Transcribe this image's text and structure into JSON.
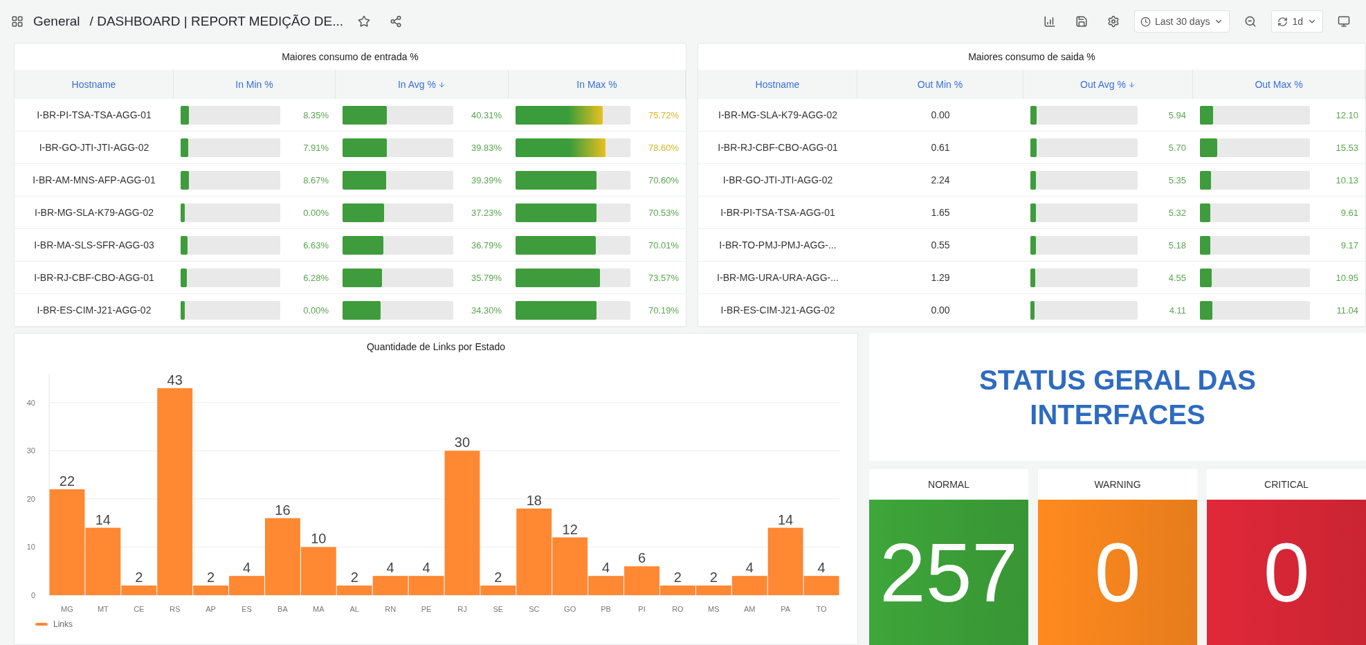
{
  "topbar": {
    "breadcrumb": "General",
    "title": "/ DASHBOARD | REPORT MEDIÇÃO DE...",
    "time_range": "Last 30 days",
    "refresh_interval": "1d"
  },
  "tables": [
    {
      "title": "Maiores consumo de entrada %",
      "columns": [
        {
          "label": "Hostname",
          "sorted": false
        },
        {
          "label": "In Min %",
          "sorted": false
        },
        {
          "label": "In Avg %",
          "sorted": true
        },
        {
          "label": "In Max %",
          "sorted": false
        }
      ],
      "rows": [
        {
          "cells": [
            {
              "kind": "text",
              "text": "I-BR-PI-TSA-TSA-AGG-01"
            },
            {
              "kind": "gauge",
              "text": "8.35%",
              "level": 0.0835
            },
            {
              "kind": "gauge",
              "text": "40.31%",
              "level": 0.4031
            },
            {
              "kind": "gauge",
              "text": "75.72%",
              "level": 0.7572
            }
          ]
        },
        {
          "cells": [
            {
              "kind": "text",
              "text": "I-BR-GO-JTI-JTI-AGG-02"
            },
            {
              "kind": "gauge",
              "text": "7.91%",
              "level": 0.0791
            },
            {
              "kind": "gauge",
              "text": "39.83%",
              "level": 0.3983
            },
            {
              "kind": "gauge",
              "text": "78.60%",
              "level": 0.786
            }
          ]
        },
        {
          "cells": [
            {
              "kind": "text",
              "text": "I-BR-AM-MNS-AFP-AGG-01"
            },
            {
              "kind": "gauge",
              "text": "8.67%",
              "level": 0.0867
            },
            {
              "kind": "gauge",
              "text": "39.39%",
              "level": 0.3939
            },
            {
              "kind": "gauge",
              "text": "70.60%",
              "level": 0.706
            }
          ]
        },
        {
          "cells": [
            {
              "kind": "text",
              "text": "I-BR-MG-SLA-K79-AGG-02"
            },
            {
              "kind": "gauge",
              "text": "0.00%",
              "level": 0.0
            },
            {
              "kind": "gauge",
              "text": "37.23%",
              "level": 0.3723
            },
            {
              "kind": "gauge",
              "text": "70.53%",
              "level": 0.7053
            }
          ]
        },
        {
          "cells": [
            {
              "kind": "text",
              "text": "I-BR-MA-SLS-SFR-AGG-03"
            },
            {
              "kind": "gauge",
              "text": "6.63%",
              "level": 0.0663
            },
            {
              "kind": "gauge",
              "text": "36.79%",
              "level": 0.3679
            },
            {
              "kind": "gauge",
              "text": "70.01%",
              "level": 0.7001
            }
          ]
        },
        {
          "cells": [
            {
              "kind": "text",
              "text": "I-BR-RJ-CBF-CBO-AGG-01"
            },
            {
              "kind": "gauge",
              "text": "6.28%",
              "level": 0.0628
            },
            {
              "kind": "gauge",
              "text": "35.79%",
              "level": 0.3579
            },
            {
              "kind": "gauge",
              "text": "73.57%",
              "level": 0.7357
            }
          ]
        },
        {
          "cells": [
            {
              "kind": "text",
              "text": "I-BR-ES-CIM-J21-AGG-02"
            },
            {
              "kind": "gauge",
              "text": "0.00%",
              "level": 0.0
            },
            {
              "kind": "gauge",
              "text": "34.30%",
              "level": 0.343
            },
            {
              "kind": "gauge",
              "text": "70.19%",
              "level": 0.7019
            }
          ]
        }
      ]
    },
    {
      "title": "Maiores consumo de saida %",
      "columns": [
        {
          "label": "Hostname",
          "sorted": false
        },
        {
          "label": "Out Min %",
          "sorted": false
        },
        {
          "label": "Out Avg %",
          "sorted": true
        },
        {
          "label": "Out Max %",
          "sorted": false
        }
      ],
      "rows": [
        {
          "cells": [
            {
              "kind": "text",
              "text": "I-BR-MG-SLA-K79-AGG-02"
            },
            {
              "kind": "text",
              "text": "0.00"
            },
            {
              "kind": "gauge",
              "text": "5.94",
              "level": 0.0594
            },
            {
              "kind": "gauge",
              "text": "12.10",
              "level": 0.121
            }
          ]
        },
        {
          "cells": [
            {
              "kind": "text",
              "text": "I-BR-RJ-CBF-CBO-AGG-01"
            },
            {
              "kind": "text",
              "text": "0.61"
            },
            {
              "kind": "gauge",
              "text": "5.70",
              "level": 0.057
            },
            {
              "kind": "gauge",
              "text": "15.53",
              "level": 0.1553
            }
          ]
        },
        {
          "cells": [
            {
              "kind": "text",
              "text": "I-BR-GO-JTI-JTI-AGG-02"
            },
            {
              "kind": "text",
              "text": "2.24"
            },
            {
              "kind": "gauge",
              "text": "5.35",
              "level": 0.0535
            },
            {
              "kind": "gauge",
              "text": "10.13",
              "level": 0.1013
            }
          ]
        },
        {
          "cells": [
            {
              "kind": "text",
              "text": "I-BR-PI-TSA-TSA-AGG-01"
            },
            {
              "kind": "text",
              "text": "1.65"
            },
            {
              "kind": "gauge",
              "text": "5.32",
              "level": 0.0532
            },
            {
              "kind": "gauge",
              "text": "9.61",
              "level": 0.0961
            }
          ]
        },
        {
          "cells": [
            {
              "kind": "text",
              "text": "I-BR-TO-PMJ-PMJ-AGG-..."
            },
            {
              "kind": "text",
              "text": "0.55"
            },
            {
              "kind": "gauge",
              "text": "5.18",
              "level": 0.0518
            },
            {
              "kind": "gauge",
              "text": "9.17",
              "level": 0.0917
            }
          ]
        },
        {
          "cells": [
            {
              "kind": "text",
              "text": "I-BR-MG-URA-URA-AGG-..."
            },
            {
              "kind": "text",
              "text": "1.29"
            },
            {
              "kind": "gauge",
              "text": "4.55",
              "level": 0.0455
            },
            {
              "kind": "gauge",
              "text": "10.95",
              "level": 0.1095
            }
          ]
        },
        {
          "cells": [
            {
              "kind": "text",
              "text": "I-BR-ES-CIM-J21-AGG-02"
            },
            {
              "kind": "text",
              "text": "0.00"
            },
            {
              "kind": "gauge",
              "text": "4.11",
              "level": 0.0411
            },
            {
              "kind": "gauge",
              "text": "11.04",
              "level": 0.1104
            }
          ]
        }
      ]
    }
  ],
  "chart_panel": {
    "title": "Quantidade de Links por Estado",
    "chart_data": {
      "type": "bar",
      "categories": [
        "MG",
        "MT",
        "CE",
        "RS",
        "AP",
        "ES",
        "BA",
        "MA",
        "AL",
        "RN",
        "PE",
        "RJ",
        "SE",
        "SC",
        "GO",
        "PB",
        "PI",
        "RO",
        "MS",
        "AM",
        "PA",
        "TO"
      ],
      "series": [
        {
          "name": "Links",
          "color": "#ff8833",
          "values": [
            22,
            14,
            2,
            43,
            2,
            4,
            16,
            10,
            2,
            4,
            4,
            30,
            2,
            18,
            12,
            4,
            6,
            2,
            2,
            4,
            14,
            4
          ]
        }
      ],
      "ylim": [
        0,
        46
      ],
      "yticks": [
        0,
        10,
        20,
        30,
        40
      ],
      "grid": true,
      "data_labels": true
    }
  },
  "status": {
    "title": "STATUS GERAL DAS INTERFACES",
    "stats": [
      {
        "label": "NORMAL",
        "value": "257",
        "color": "#3ea63a"
      },
      {
        "label": "WARNING",
        "value": "0",
        "color": "#ff8a1f"
      },
      {
        "label": "CRITICAL",
        "value": "0",
        "color": "#e02838"
      }
    ]
  }
}
